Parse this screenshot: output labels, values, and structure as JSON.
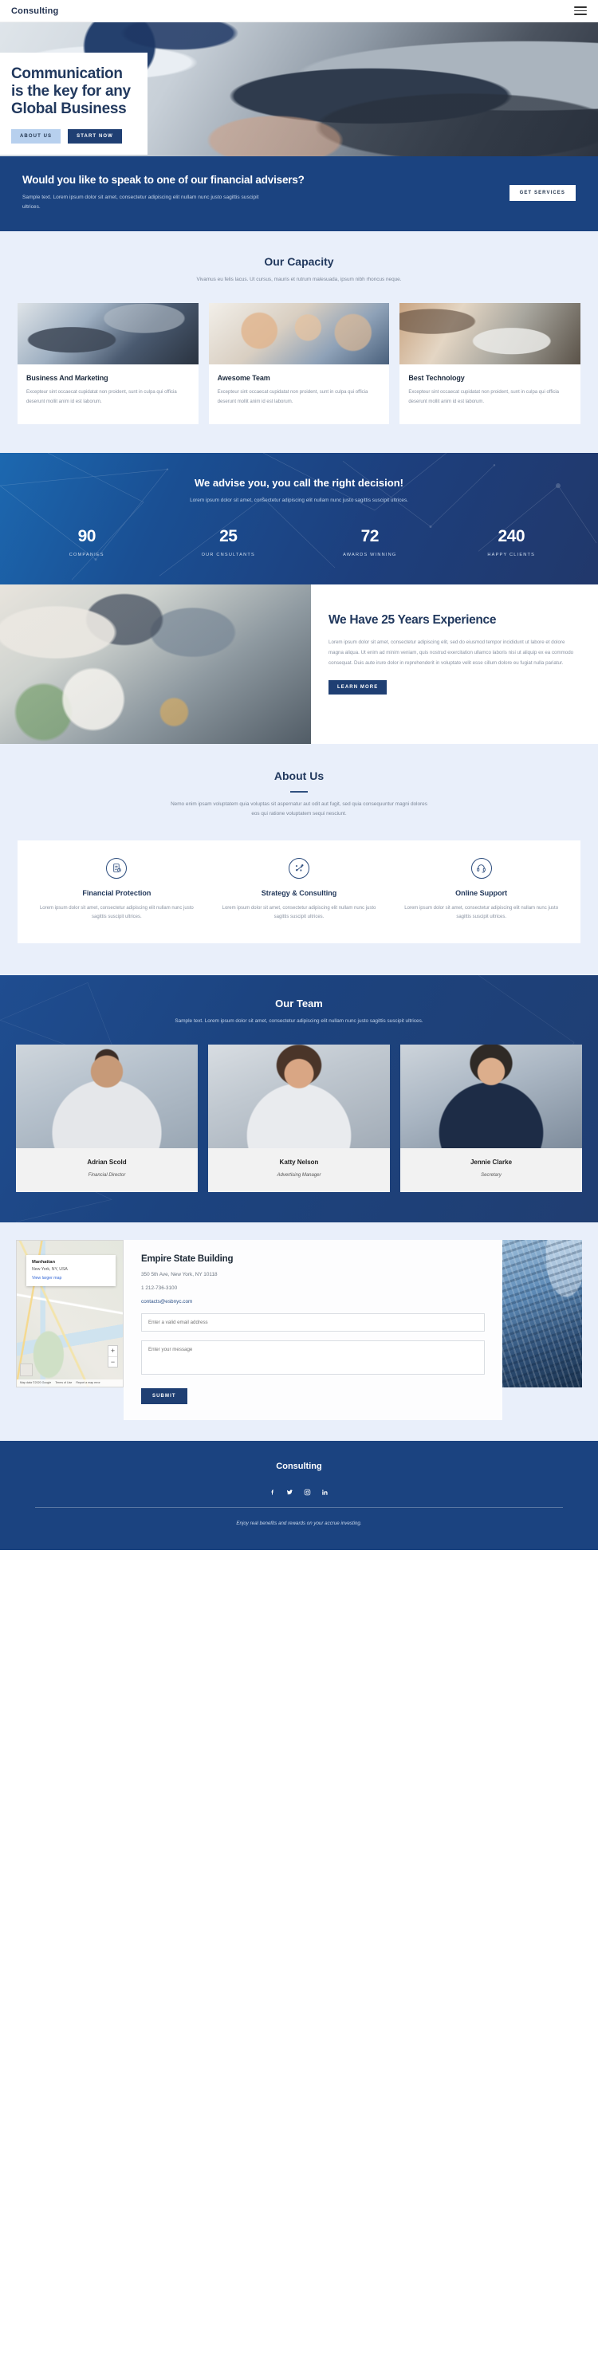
{
  "nav": {
    "brand": "Consulting",
    "menu_icon": "hamburger-menu-icon"
  },
  "hero": {
    "title": "Communication is the key for any Global Business",
    "btn_primary": "About Us",
    "btn_secondary": "Start Now"
  },
  "adviser": {
    "heading": "Would you like to speak to one of our financial advisers?",
    "text": "Sample text. Lorem ipsum dolor sit amet, consectetur adipiscing elit nullam nunc justo sagittis suscipit ultrices.",
    "button": "Get Services"
  },
  "capacity": {
    "title": "Our Capacity",
    "subtitle": "Vivamus eu felis lacus. Ut cursus, mauris et rutrum malesuada, ipsum nibh rhoncus neque.",
    "cards": [
      {
        "title": "Business And Marketing",
        "text": "Excepteur sint occaecat cupidatat non proident, sunt in culpa qui officia deserunt mollit anim id est laborum."
      },
      {
        "title": "Awesome Team",
        "text": "Excepteur sint occaecat cupidatat non proident, sunt in culpa qui officia deserunt mollit anim id est laborum."
      },
      {
        "title": "Best Technology",
        "text": "Excepteur sint occaecat cupidatat non proident, sunt in culpa qui officia deserunt mollit anim id est laborum."
      }
    ]
  },
  "stats": {
    "heading": "We advise you, you call the right decision!",
    "text": "Lorem ipsum dolor sit amet, consectetur adipiscing elit nullam nunc justo sagittis suscipit ultrices.",
    "items": [
      {
        "number": "90",
        "label": "Companies"
      },
      {
        "number": "25",
        "label": "Our Cnsultants"
      },
      {
        "number": "72",
        "label": "Awards Winning"
      },
      {
        "number": "240",
        "label": "Happy Clients"
      }
    ]
  },
  "experience": {
    "heading": "We Have 25 Years Experience",
    "text": "Lorem ipsum dolor sit amet, consectetur adipiscing elit, sed do eiusmod tempor incididunt ut labore et dolore magna aliqua. Ut enim ad minim veniam, quis nostrud exercitation ullamco laboris nisi ut aliquip ex ea commodo consequat. Duis aute irure dolor in reprehenderit in voluptate velit esse cillum dolore eu fugiat nulla pariatur.",
    "button": "Learn More"
  },
  "about": {
    "title": "About Us",
    "subtitle": "Nemo enim ipsam voluptatem quia voluptas sit aspernatur aut odit aut fugit, sed quia consequuntur magni dolores eos qui ratione voluptatem sequi nesciunt.",
    "features": [
      {
        "icon": "checklist-clipboard-icon",
        "title": "Financial Protection",
        "text": "Lorem ipsum dolor sit amet, consectetur adipiscing elit nullam nunc justo sagittis suscipit ultrices."
      },
      {
        "icon": "strategy-tactics-icon",
        "title": "Strategy & Consulting",
        "text": "Lorem ipsum dolor sit amet, consectetur adipiscing elit nullam nunc justo sagittis suscipit ultrices."
      },
      {
        "icon": "headset-support-icon",
        "title": "Online Support",
        "text": "Lorem ipsum dolor sit amet, consectetur adipiscing elit nullam nunc justo sagittis suscipit ultrices."
      }
    ]
  },
  "team": {
    "title": "Our Team",
    "subtitle": "Sample text. Lorem ipsum dolor sit amet, consectetur adipiscing elit nullam nunc justo sagittis suscipit ultrices.",
    "members": [
      {
        "name": "Adrian Scold",
        "role": "Financial Director"
      },
      {
        "name": "Katty Nelson",
        "role": "Advertising Manager"
      },
      {
        "name": "Jennie Clarke",
        "role": "Secretary"
      }
    ]
  },
  "contact": {
    "map": {
      "place": "Manhattan",
      "region": "New York, NY, USA",
      "link": "View larger map",
      "zoom_in": "+",
      "zoom_out": "−",
      "attribution": "Map data ©2020 Google",
      "terms": "Terms of Use",
      "report": "Report a map error"
    },
    "title": "Empire State Building",
    "address": "350 5th Ave, New York, NY 10118",
    "phone": "1 212-736-3100",
    "email": "contacts@esbnyc.com",
    "email_placeholder": "Enter a valid email address",
    "email_value": "",
    "message_placeholder": "Enter your message",
    "message_value": "",
    "submit": "Submit"
  },
  "footer": {
    "brand": "Consulting",
    "social": [
      {
        "icon": "facebook-icon",
        "glyph": "f"
      },
      {
        "icon": "twitter-icon",
        "glyph": "ᵛ"
      },
      {
        "icon": "instagram-icon",
        "glyph": "▢"
      },
      {
        "icon": "linkedin-icon",
        "glyph": "in"
      }
    ],
    "note": "Enjoy real benefits and rewards on your accrue investing."
  },
  "colors": {
    "brand_blue": "#1b4380",
    "deep_navy": "#22395e",
    "light_blue": "#b7d0ee",
    "pale_bg": "#e9effa"
  }
}
